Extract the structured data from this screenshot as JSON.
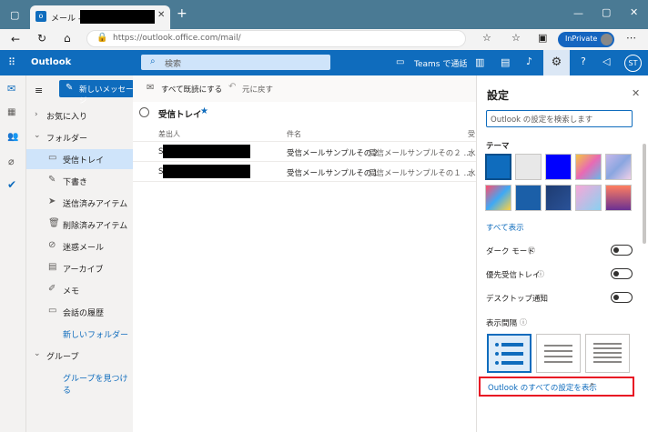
{
  "browser": {
    "tab_title": "メール -",
    "url": "https://outlook.office.com/mail/",
    "url_host": "outlook.office.com",
    "url_prefix": "https://",
    "url_path": "/mail/",
    "inprivate_label": "InPrivate"
  },
  "outlook": {
    "brand": "Outlook",
    "search_placeholder": "検索",
    "teams_label": "Teams で通話",
    "user_initials": "ST"
  },
  "commands": {
    "new_message": "新しいメッセージ",
    "mark_all_read": "すべて既読にする",
    "undo": "元に戻す"
  },
  "nav": {
    "favorites": "お気に入り",
    "folders": "フォルダー",
    "items": [
      {
        "label": "受信トレイ",
        "icon": "inbox-icon",
        "selected": true
      },
      {
        "label": "下書き",
        "icon": "pencil-icon"
      },
      {
        "label": "送信済みアイテム",
        "icon": "send-icon"
      },
      {
        "label": "削除済みアイテム",
        "icon": "trash-icon"
      },
      {
        "label": "迷惑メール",
        "icon": "junk-icon"
      },
      {
        "label": "アーカイブ",
        "icon": "archive-icon"
      },
      {
        "label": "メモ",
        "icon": "note-icon"
      },
      {
        "label": "会話の履歴",
        "icon": "history-icon"
      }
    ],
    "new_folder": "新しいフォルダー",
    "groups": "グループ",
    "find_groups": "グループを見つける"
  },
  "maillist": {
    "folder_title": "受信トレイ",
    "columns": {
      "from": "差出人",
      "subject": "件名",
      "received": "受"
    },
    "rows": [
      {
        "from_initial": "S",
        "subject": "受信メールサンプルその２",
        "preview": "受信メールサンプルその２ ...",
        "date_initial": "水"
      },
      {
        "from_initial": "S",
        "subject": "受信メールサンプルその１",
        "preview": "受信メールサンプルその１ ...",
        "date_initial": "水"
      }
    ]
  },
  "settings": {
    "title": "設定",
    "search_placeholder": "Outlook の設定を検索します",
    "theme_label": "テーマ",
    "show_all": "すべて表示",
    "dark_mode": "ダーク モード",
    "focused_inbox": "優先受信トレイ",
    "desktop_notifications": "デスクトップ通知",
    "density": "表示間隔",
    "view_all_settings": "Outlook のすべての設定を表示"
  },
  "colors": {
    "accent": "#0f6cbd",
    "highlight_border": "#e81123",
    "link": "#0f6cbd"
  }
}
